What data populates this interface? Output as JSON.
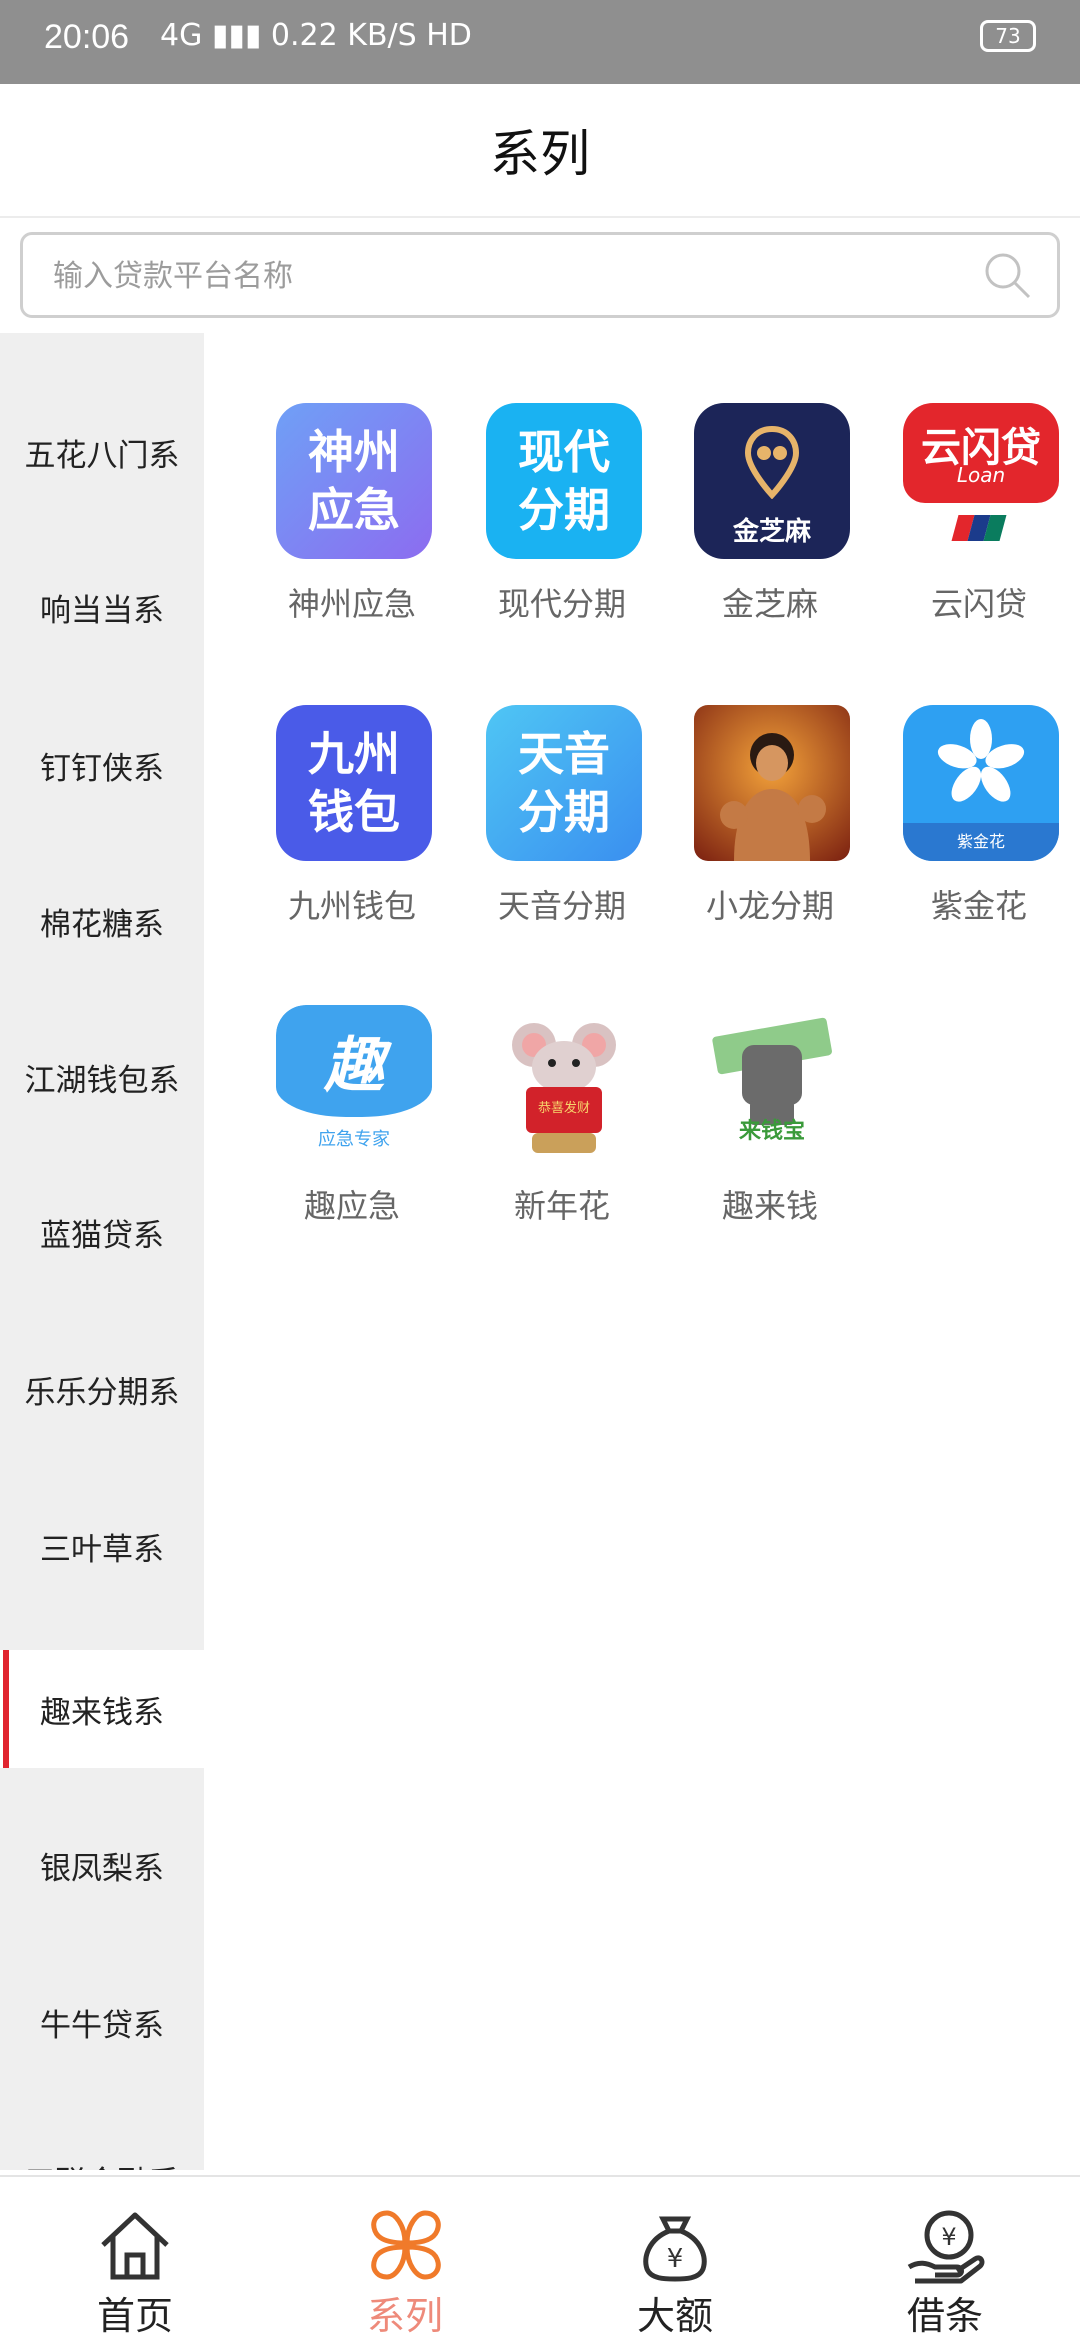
{
  "status_bar": {
    "time": "20:06",
    "network": "4G ▮▮▮ 0.22 KB/S HD",
    "battery": "73"
  },
  "header": {
    "title": "系列"
  },
  "search": {
    "placeholder": "输入贷款平台名称",
    "value": ""
  },
  "sidebar": {
    "items": [
      {
        "label": "五花八门系"
      },
      {
        "label": "响当当系"
      },
      {
        "label": "钉钉侠系"
      },
      {
        "label": "棉花糖系"
      },
      {
        "label": "江湖钱包系"
      },
      {
        "label": "蓝猫贷系"
      },
      {
        "label": "乐乐分期系"
      },
      {
        "label": "三叶草系"
      },
      {
        "label": "趣来钱系"
      },
      {
        "label": "银凤梨系"
      },
      {
        "label": "牛牛贷系"
      },
      {
        "label": "三联金融系"
      }
    ],
    "active": "趣来钱系"
  },
  "apps": [
    {
      "name": "神州应急",
      "icon_text": [
        "神州",
        "应急"
      ],
      "color": "#7b7ff0"
    },
    {
      "name": "现代分期",
      "icon_text": [
        "现代",
        "分期"
      ],
      "color": "#1ab2f2"
    },
    {
      "name": "金芝麻",
      "icon_text": [
        "金芝麻"
      ],
      "color": "#1c2558"
    },
    {
      "name": "云闪贷",
      "icon_text": [
        "云闪贷",
        "Loan"
      ],
      "color": "#e3262c"
    },
    {
      "name": "九州钱包",
      "icon_text": [
        "九州",
        "钱包"
      ],
      "color": "#4a5be8"
    },
    {
      "name": "天音分期",
      "icon_text": [
        "天音",
        "分期"
      ],
      "color": "#3aa6f2"
    },
    {
      "name": "小龙分期",
      "icon_text": [],
      "color": "#c2562a"
    },
    {
      "name": "紫金花",
      "icon_text": [
        "紫金花"
      ],
      "color": "#2ea0f2"
    },
    {
      "name": "趣应急",
      "icon_text": [
        "趣",
        "应急专家"
      ],
      "color": "#3fa3ee"
    },
    {
      "name": "新年花",
      "icon_text": [
        "恭喜发财"
      ],
      "color": "#ffffff"
    },
    {
      "name": "趣来钱",
      "icon_text": [
        "来钱宝"
      ],
      "color": "#ffffff"
    }
  ],
  "bottom_nav": {
    "items": [
      {
        "label": "首页",
        "icon": "home-icon"
      },
      {
        "label": "系列",
        "icon": "clover-icon"
      },
      {
        "label": "大额",
        "icon": "money-bag-icon"
      },
      {
        "label": "借条",
        "icon": "hand-coin-icon"
      }
    ],
    "active": "系列",
    "active_color": "#ee8a7a"
  }
}
